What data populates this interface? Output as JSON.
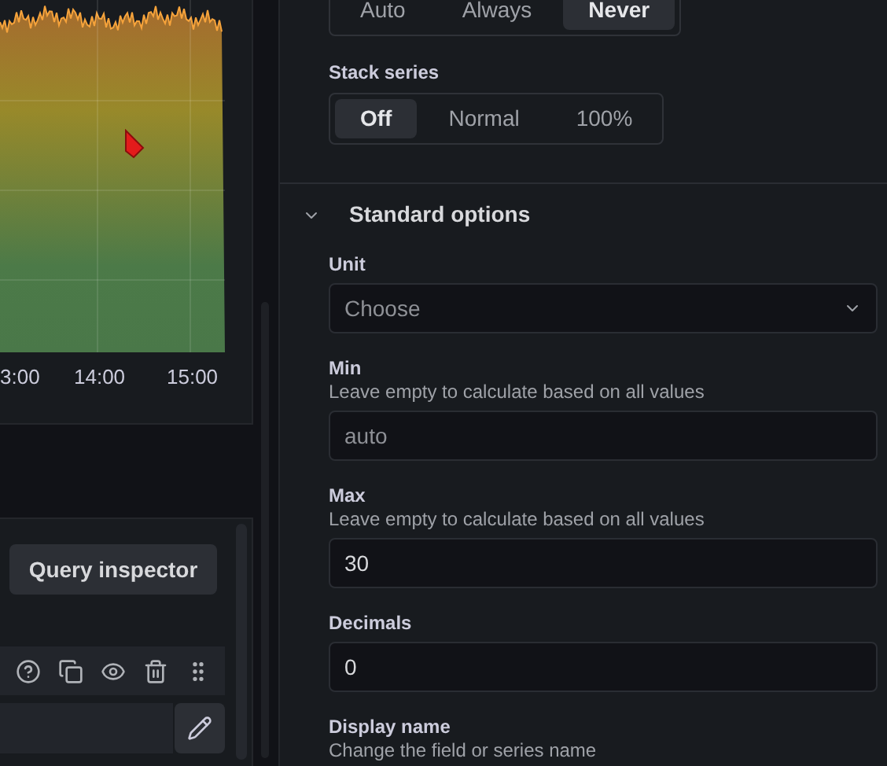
{
  "chart": {
    "x_labels": [
      "3:00",
      "14:00",
      "15:00"
    ]
  },
  "query_panel": {
    "inspector_button": "Query inspector"
  },
  "gradient_mode": {
    "options": [
      {
        "label": "Auto",
        "selected": false
      },
      {
        "label": "Always",
        "selected": false
      },
      {
        "label": "Never",
        "selected": true
      }
    ]
  },
  "stack_series": {
    "label": "Stack series",
    "options": [
      {
        "label": "Off",
        "selected": true
      },
      {
        "label": "Normal",
        "selected": false
      },
      {
        "label": "100%",
        "selected": false
      }
    ]
  },
  "standard_options": {
    "title": "Standard options",
    "expanded": true,
    "fields": [
      {
        "kind": "select",
        "label": "Unit",
        "placeholder": "Choose"
      },
      {
        "kind": "input",
        "label": "Min",
        "description": "Leave empty to calculate based on all values",
        "placeholder": "auto"
      },
      {
        "kind": "input",
        "label": "Max",
        "description": "Leave empty to calculate based on all values",
        "value": "30"
      },
      {
        "kind": "input",
        "label": "Decimals",
        "value": "0"
      },
      {
        "kind": "label",
        "label": "Display name",
        "description": "Change the field or series name"
      }
    ]
  }
}
